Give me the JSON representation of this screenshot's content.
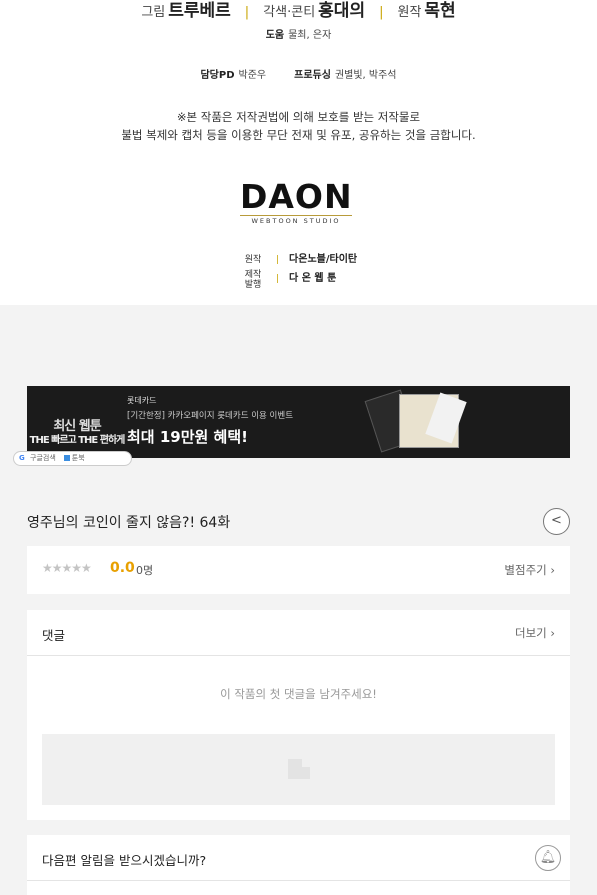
{
  "credits": {
    "art_role": "그림",
    "art_name": "트루베르",
    "script_role": "각색·콘티",
    "script_name": "홍대의",
    "original_role": "원작",
    "original_name": "목현",
    "assist_label": "도움",
    "assist_names": "물최, 은자",
    "pd_label": "담당PD",
    "pd_name": "박준우",
    "producing_label": "프로듀싱",
    "producing_names": "권별빛, 박주석",
    "notice_line1": "※본 작품은 저작권법에 의해 보호를 받는 저작물로",
    "notice_line2": "불법 복제와 캡처 등을 이용한 무단 전재 및 유포, 공유하는 것을 금합니다."
  },
  "logo": {
    "main": "DAON",
    "sub": "WEBTOON STUDIO"
  },
  "publisher": {
    "original_label": "원작",
    "original_value": "다온노블/타이탄",
    "production_label_1": "제작",
    "production_label_2": "발행",
    "production_value": "다 온 웹 툰"
  },
  "banner": {
    "left_line1": "최신 웹툰",
    "left_line2": "THE 빠르고 THE 편하게",
    "brand": "롯데카드",
    "promo": "[기간한정] 카카오페이지 롯데카드 이용 이벤트",
    "headline": "최대 19만원 혜택!"
  },
  "search_pill": {
    "google_label": "구글검색",
    "app_label": "툰북"
  },
  "episode": {
    "title": "영주님의 코인이 줄지 않음?! 64화"
  },
  "rating": {
    "stars": "★★★★★",
    "score": "0.0",
    "count": "0명",
    "rate_label": "별점주기 ›"
  },
  "comments": {
    "title": "댓글",
    "more_label": "더보기 ›",
    "empty_message": "이 작품의 첫 댓글을 남겨주세요!"
  },
  "notify": {
    "question": "다음편 알림을 받으시겠습니까?"
  }
}
